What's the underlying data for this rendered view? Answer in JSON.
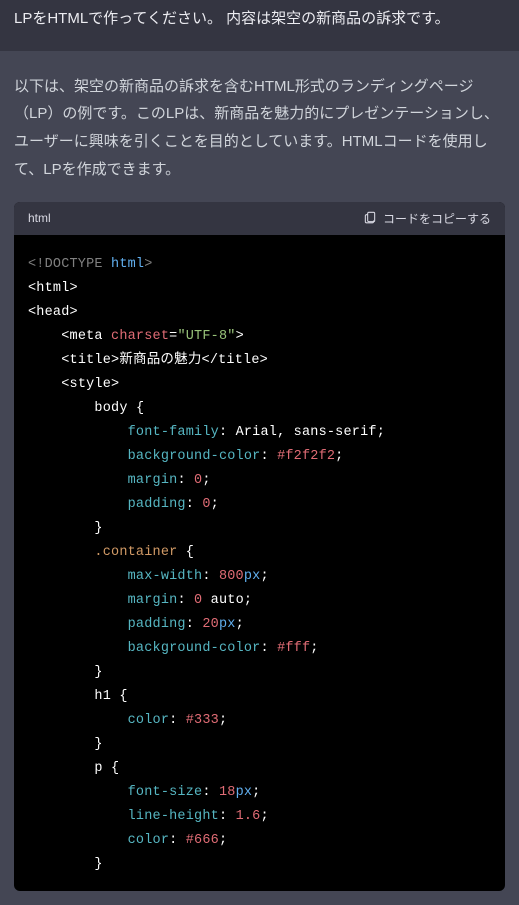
{
  "user": {
    "message": "LPをHTMLで作ってください。 内容は架空の新商品の訴求です。"
  },
  "assistant": {
    "intro": "以下は、架空の新商品の訴求を含むHTML形式のランディングページ（LP）の例です。このLPは、新商品を魅力的にプレゼンテーションし、ユーザーに興味を引くことを目的としています。HTMLコードを使用して、LPを作成できます。"
  },
  "code_header": {
    "lang": "html",
    "copy_label": "コードをコピーする"
  },
  "code": {
    "doctype_excl": "<!DOCTYPE ",
    "doctype_html": "html",
    "doctype_close": ">",
    "html_open": "<html>",
    "head_open": "<head>",
    "meta_open": "<meta ",
    "charset_attr": "charset",
    "eq": "=",
    "utf8": "\"UTF-8\"",
    "tag_close": ">",
    "title_open": "<title>",
    "title_text": "新商品の魅力",
    "title_close": "</title>",
    "style_open": "<style>",
    "sel_body": "body",
    "brace_open": " {",
    "brace_close": "}",
    "p_ff": "font-family",
    "colon": ": ",
    "v_ff": "Arial, sans-serif",
    "semi": ";",
    "p_bg": "background-color",
    "v_bg1": "#f2f2f2",
    "p_margin": "margin",
    "v_zero": "0",
    "p_padding": "padding",
    "sel_container": ".container",
    "p_maxw": "max-width",
    "v_800": "800",
    "u_px": "px",
    "v_auto": " auto",
    "v_20": "20",
    "v_bg2": "#fff",
    "sel_h1": "h1",
    "p_color": "color",
    "v_333": "#333",
    "sel_p": "p",
    "p_fs": "font-size",
    "v_18": "18",
    "p_lh": "line-height",
    "v_16": "1.6",
    "v_666": "#666"
  }
}
